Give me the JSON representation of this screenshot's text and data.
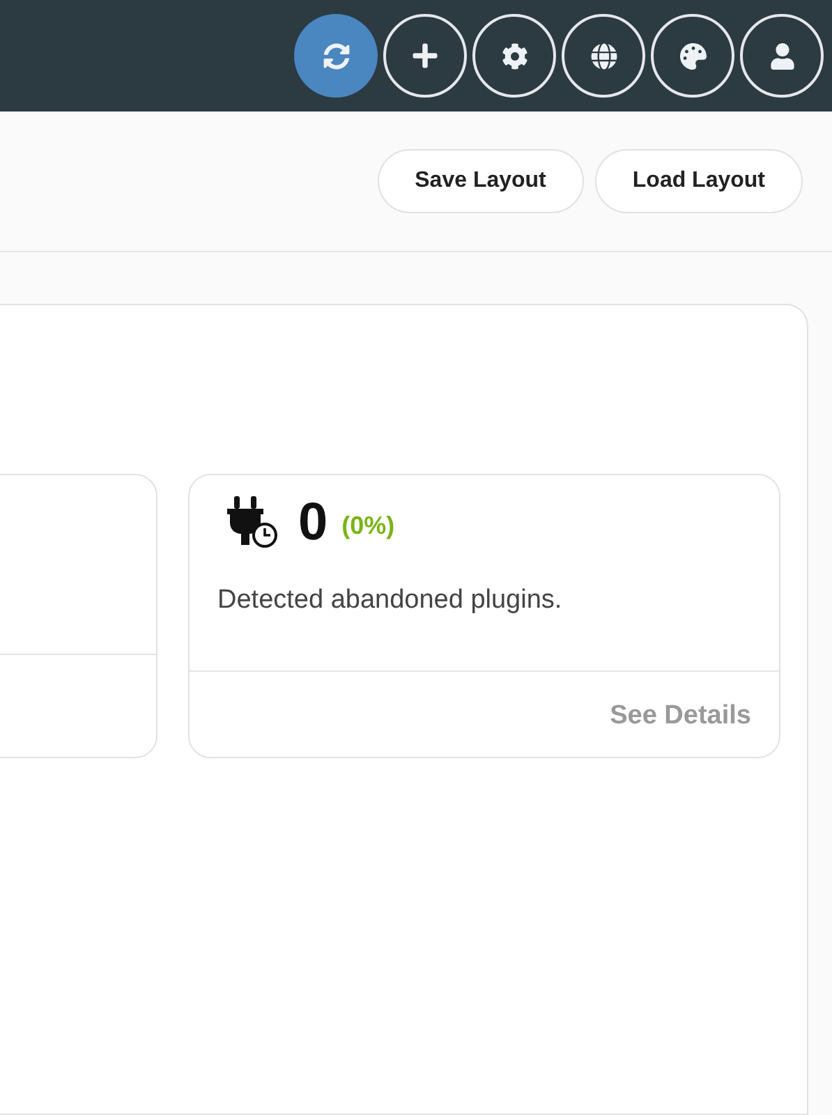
{
  "header": {
    "buttons": [
      {
        "kind": "refresh",
        "selected": true
      },
      {
        "kind": "add",
        "selected": false
      },
      {
        "kind": "settings",
        "selected": false
      },
      {
        "kind": "language",
        "selected": false
      },
      {
        "kind": "theme",
        "selected": false
      },
      {
        "kind": "account",
        "selected": false
      }
    ]
  },
  "toolbar": {
    "buttons": [
      "Save Layout",
      "Load Layout"
    ]
  },
  "widget": {
    "count": "0",
    "percent": "(0%)",
    "description": "Detected abandoned plugins.",
    "link": "See Details"
  }
}
